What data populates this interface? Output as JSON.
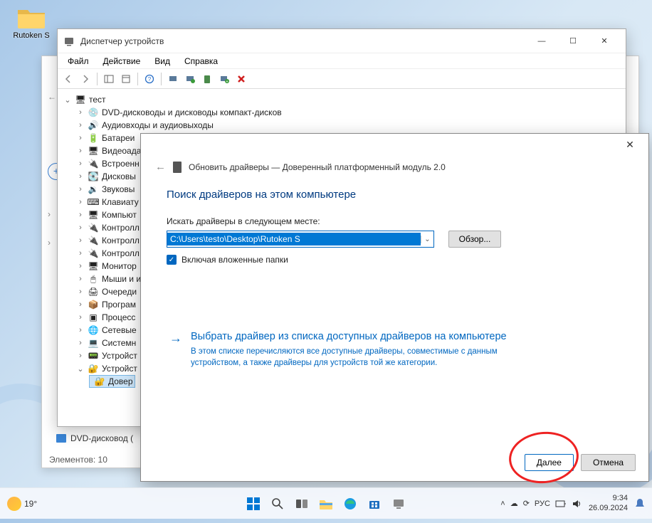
{
  "desktop": {
    "icon_label": "Rutoken S"
  },
  "explorer": {
    "nav_item": "DVD-дисковод (",
    "status": "Элементов: 10"
  },
  "devmgr": {
    "title": "Диспетчер устройств",
    "menu": {
      "file": "Файл",
      "action": "Действие",
      "view": "Вид",
      "help": "Справка"
    },
    "root": "тест",
    "nodes": [
      "DVD-дисководы и дисководы компакт-дисков",
      "Аудиовходы и аудиовыходы",
      "Батареи",
      "Видеоада",
      "Встроенн",
      "Дисковы",
      "Звуковы",
      "Клавиату",
      "Компьют",
      "Контролл",
      "Контролл",
      "Контролл",
      "Монитор",
      "Мыши и и",
      "Очереди",
      "Програм",
      "Процесс",
      "Сетевые",
      "Системн",
      "Устройст",
      "Устройст"
    ],
    "selected_leaf": "Довер"
  },
  "dlg": {
    "header": "Обновить драйверы — Доверенный платформенный модуль 2.0",
    "h1": "Поиск драйверов на этом компьютере",
    "path_label": "Искать драйверы в следующем месте:",
    "path_value": "C:\\Users\\testo\\Desktop\\Rutoken S",
    "browse": "Обзор...",
    "include_sub": "Включая вложенные папки",
    "option_title": "Выбрать драйвер из списка доступных драйверов на компьютере",
    "option_desc": "В этом списке перечисляются все доступные драйверы, совместимые с данным устройством, а также драйверы для устройств той же категории.",
    "next": "Далее",
    "cancel": "Отмена"
  },
  "taskbar": {
    "temp": "19°",
    "lang": "РУС",
    "time": "9:34",
    "date": "26.09.2024"
  }
}
